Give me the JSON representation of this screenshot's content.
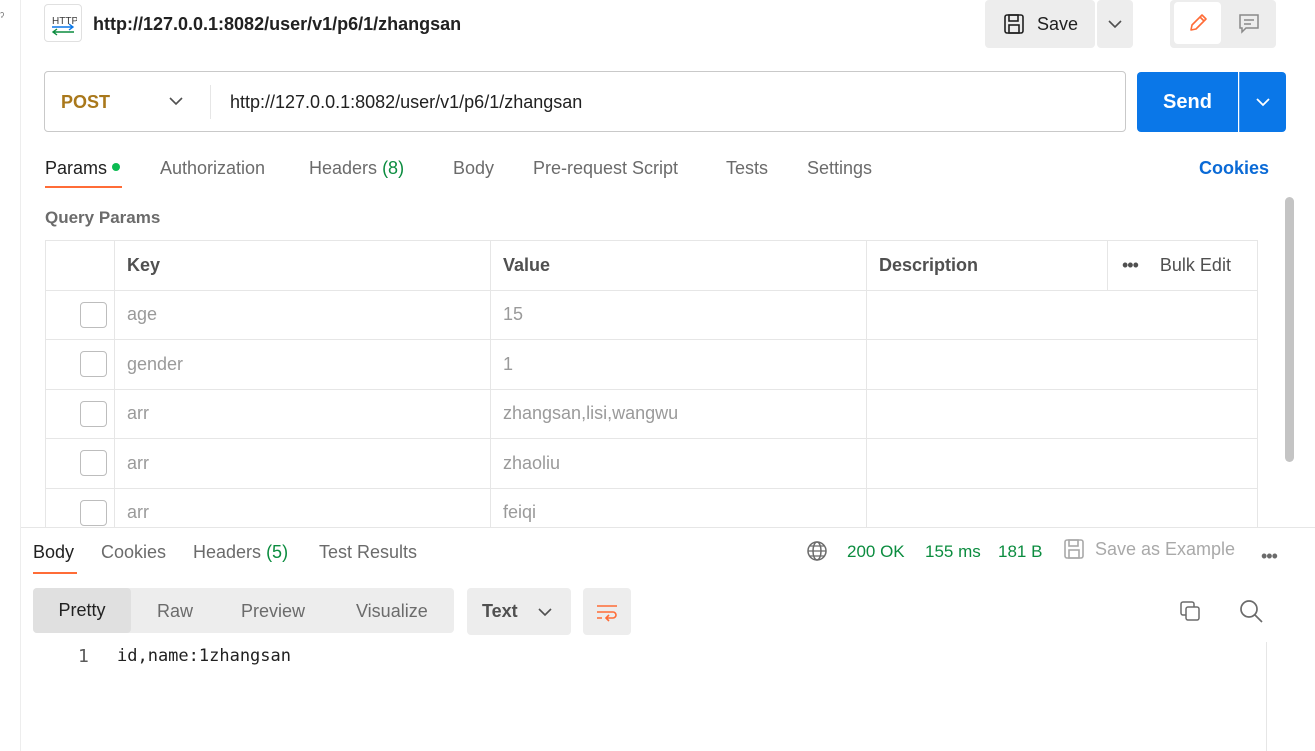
{
  "left_strip": {
    "mark": "ˀ"
  },
  "header": {
    "badge_text": "HTTP",
    "title": "http://127.0.0.1:8082/user/v1/p6/1/zhangsan",
    "save_label": "Save"
  },
  "request": {
    "method": "POST",
    "url": "http://127.0.0.1:8082/user/v1/p6/1/zhangsan",
    "send_label": "Send"
  },
  "tabs": {
    "params": "Params",
    "authorization": "Authorization",
    "headers": "Headers",
    "headers_count": "(8)",
    "body": "Body",
    "prerequest": "Pre-request Script",
    "tests": "Tests",
    "settings": "Settings",
    "cookies": "Cookies"
  },
  "query_params": {
    "label": "Query Params",
    "columns": {
      "key": "Key",
      "value": "Value",
      "description": "Description",
      "bulk_edit": "Bulk Edit"
    },
    "rows": [
      {
        "key": "age",
        "value": "15",
        "description": ""
      },
      {
        "key": "gender",
        "value": "1",
        "description": ""
      },
      {
        "key": "arr",
        "value": "zhangsan,lisi,wangwu",
        "description": ""
      },
      {
        "key": "arr",
        "value": "zhaoliu",
        "description": ""
      },
      {
        "key": "arr",
        "value": "feiqi",
        "description": ""
      }
    ]
  },
  "response": {
    "tabs": {
      "body": "Body",
      "cookies": "Cookies",
      "headers": "Headers",
      "headers_count": "(5)",
      "test_results": "Test Results"
    },
    "status": "200 OK",
    "time": "155 ms",
    "size": "181 B",
    "save_example": "Save as Example",
    "more": "•••",
    "formats": {
      "pretty": "Pretty",
      "raw": "Raw",
      "preview": "Preview",
      "visualize": "Visualize"
    },
    "type": "Text",
    "lines": [
      {
        "no": "1",
        "text": "id,name:1zhangsan"
      }
    ]
  },
  "colors": {
    "accent": "#ff6c37",
    "send": "#0a77e8",
    "method": "#a9781b",
    "status_green": "#0b8c3f",
    "link_blue": "#0a6ad6"
  }
}
